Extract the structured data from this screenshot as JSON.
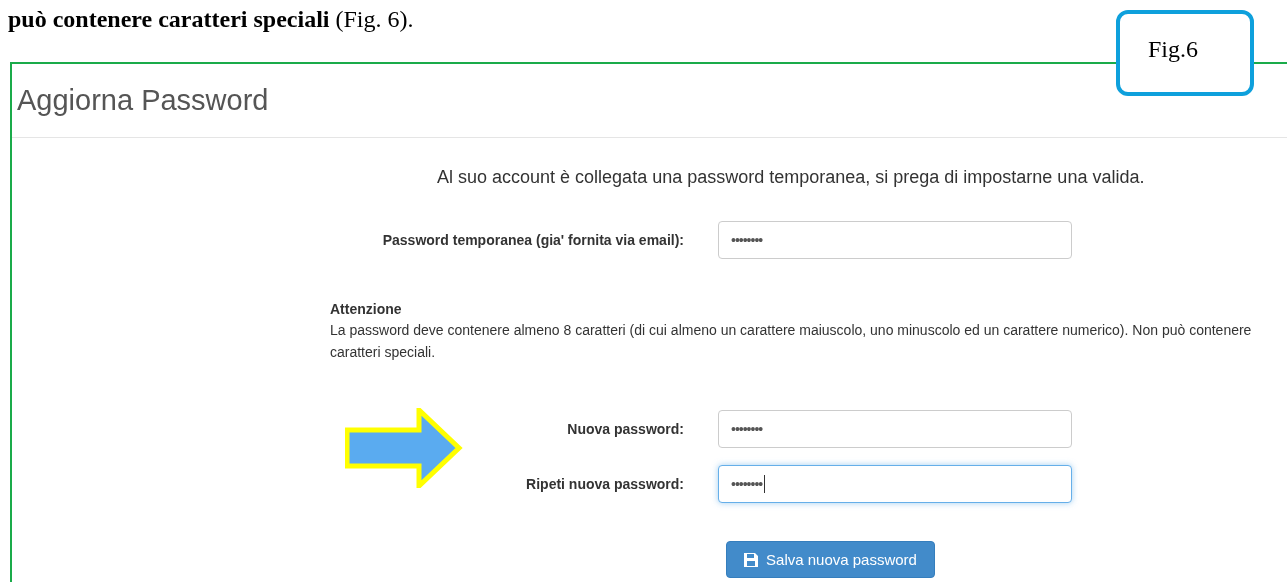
{
  "caption": "**può contenere caratteri speciali** (Fig. 6).",
  "figure_label": "Fig.6",
  "screen": {
    "title": "Aggiorna Password",
    "message": "Al suo account è collegata una password temporanea, si prega di impostarne una valida.",
    "temporary_field": {
      "label": "Password temporanea (gia' fornita via email):",
      "value": "••••••••",
      "focused": false
    },
    "notice": {
      "title": "Attenzione",
      "text": "La password deve contenere almeno 8 caratteri (di cui almeno un carattere maiuscolo, uno minuscolo ed un carattere numerico). Non può contenere caratteri speciali."
    },
    "new_fields": [
      {
        "label": "Nuova password:",
        "value": "••••••••",
        "focused": false
      },
      {
        "label": "Ripeti nuova password:",
        "value": "••••••••",
        "focused": true
      }
    ],
    "save_button": {
      "label": "Salva nuova password"
    }
  }
}
